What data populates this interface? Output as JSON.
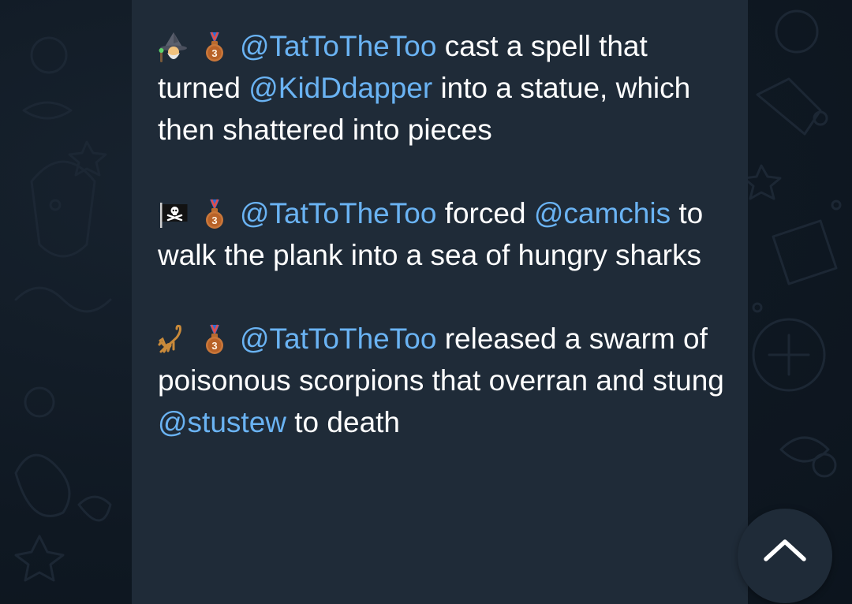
{
  "chat": {
    "messages": [
      {
        "icons": [
          "wizard-emoji",
          "third-place-medal-emoji"
        ],
        "author": "@TatToTheToo",
        "text_a": " cast a spell that turned ",
        "target": "@KidDdapper",
        "text_b": " into a statue, which then shattered into pieces"
      },
      {
        "icons": [
          "pirate-flag-emoji",
          "third-place-medal-emoji"
        ],
        "author": "@TatToTheToo",
        "text_a": " forced ",
        "target": "@camchis",
        "text_b": " to walk the plank into a sea of hungry sharks"
      },
      {
        "icons": [
          "scorpion-emoji",
          "third-place-medal-emoji"
        ],
        "author": "@TatToTheToo",
        "text_a": " released a swarm of poisonous scorpions that overran and stung ",
        "target": "@stustew",
        "text_b": " to death"
      }
    ]
  },
  "controls": {
    "scroll_button_icon": "chevron-up-icon"
  },
  "colors": {
    "background": "#0f1822",
    "bubble": "#1f2b38",
    "text": "#ffffff",
    "mention": "#6ab3f3"
  }
}
